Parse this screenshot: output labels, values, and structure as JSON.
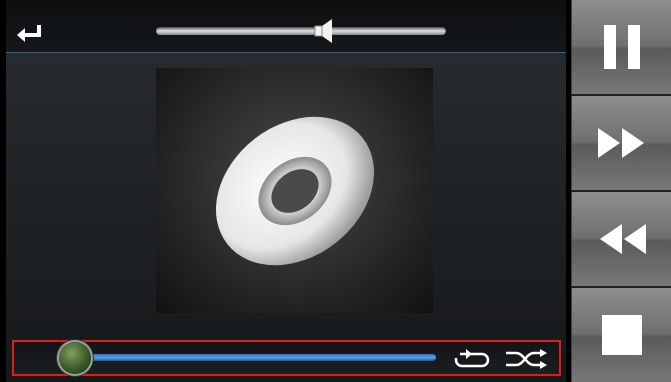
{
  "top_bar": {
    "back_icon": "return-arrow-icon",
    "volume": {
      "level": 0.58,
      "icon": "speaker-icon"
    }
  },
  "album_art": {
    "icon": "disc-icon"
  },
  "playback": {
    "progress": 0.05,
    "repeat_icon": "repeat-icon",
    "shuffle_icon": "shuffle-icon",
    "highlight_color": "#e01b1b",
    "track_color": "#3d86d8"
  },
  "side_controls": [
    {
      "name": "pause-button",
      "icon": "pause-icon"
    },
    {
      "name": "fast-forward-button",
      "icon": "fast-forward-icon"
    },
    {
      "name": "rewind-button",
      "icon": "rewind-icon"
    },
    {
      "name": "stop-button",
      "icon": "stop-icon"
    }
  ]
}
